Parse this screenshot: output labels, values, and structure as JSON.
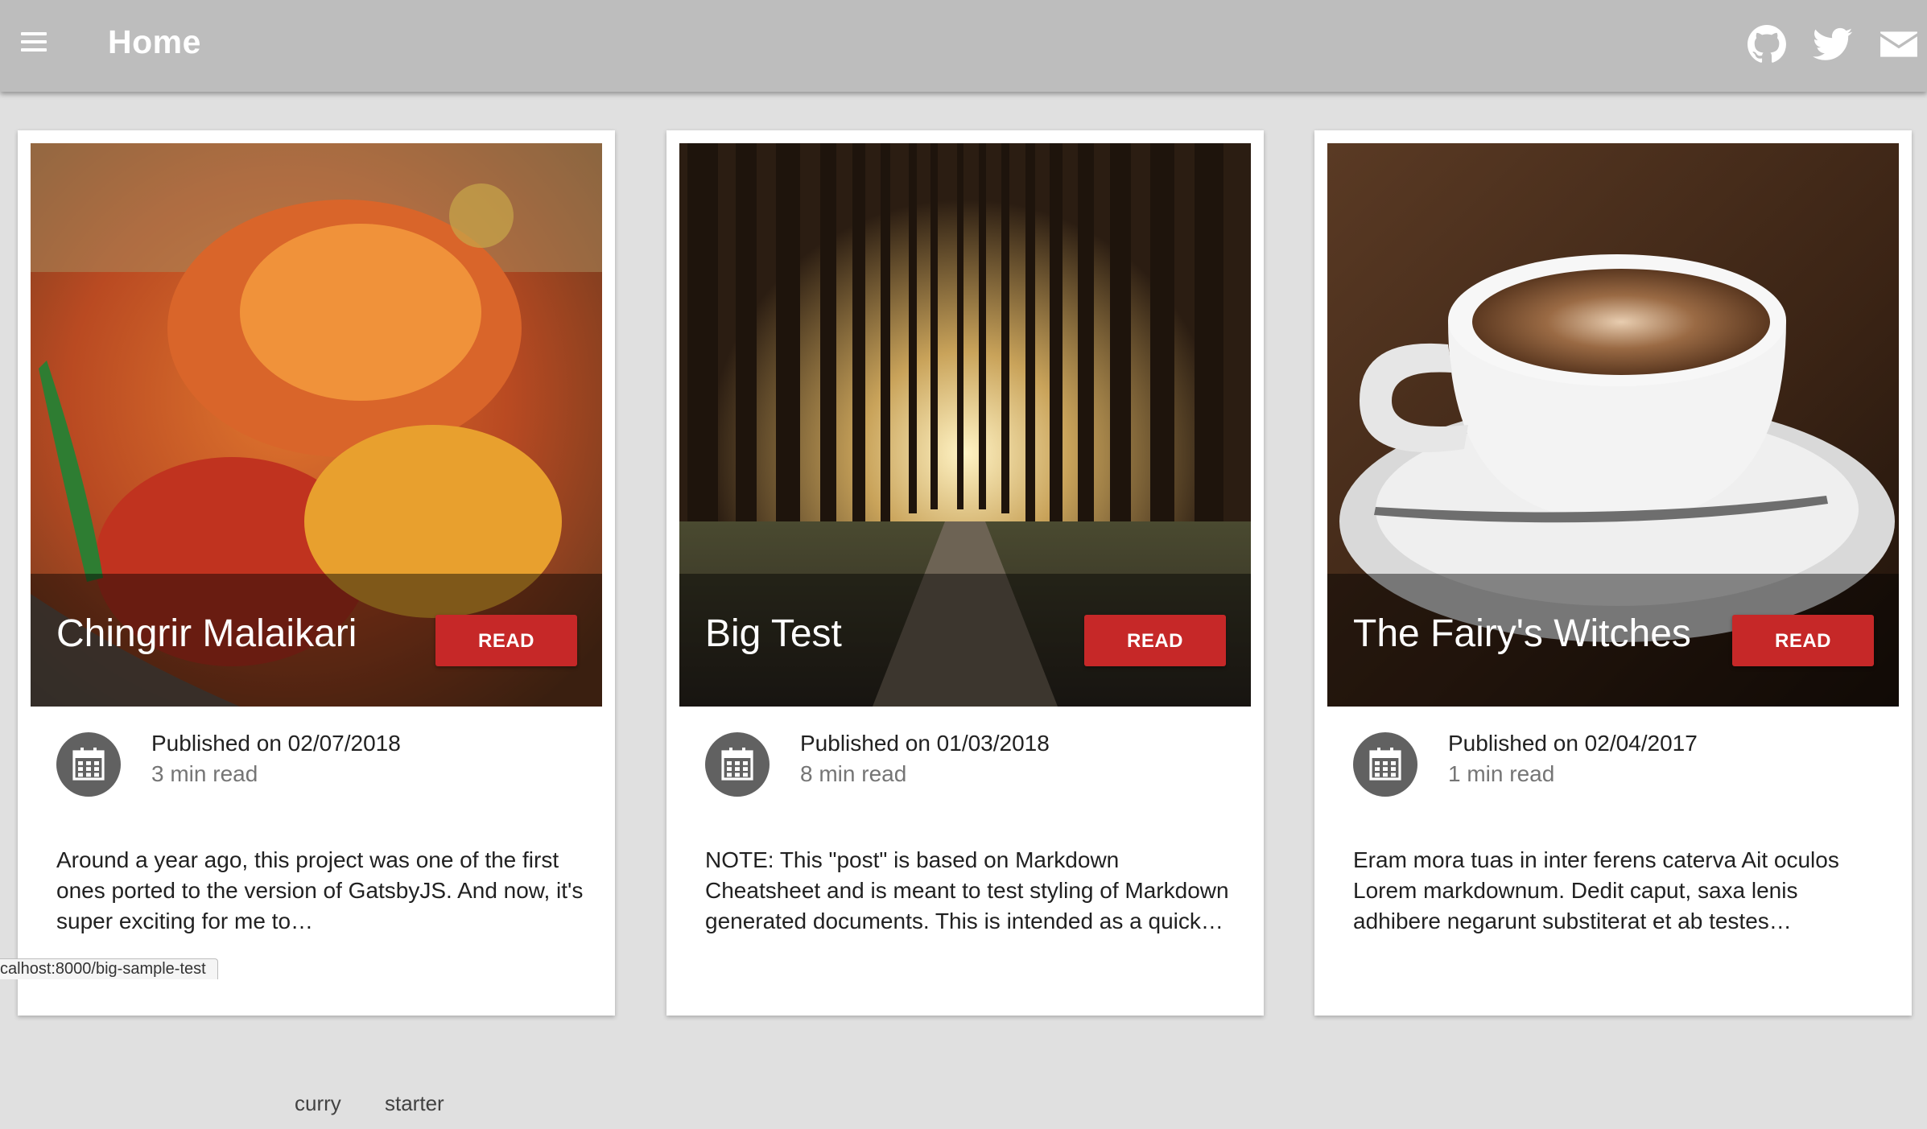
{
  "appbar": {
    "title": "Home",
    "icons": [
      "menu-icon",
      "github-icon",
      "twitter-icon",
      "mail-icon"
    ],
    "background": "#bdbdbd"
  },
  "posts": [
    {
      "title": "Chingrir Malaikari",
      "read_label": "READ",
      "published": "Published on 02/07/2018",
      "read_time": "3 min read",
      "excerpt": "Around a year ago, this project was one of the first ones ported to the version of GatsbyJS. And now, it's super exciting for me to…",
      "tags": [
        "curry",
        "starter"
      ]
    },
    {
      "title": "Big Test",
      "read_label": "READ",
      "published": "Published on 01/03/2018",
      "read_time": "8 min read",
      "excerpt": "NOTE: This \"post\" is based on Markdown Cheatsheet and is meant to test styling of Markdown generated documents. This is intended as a quick…",
      "tags": []
    },
    {
      "title": "The Fairy's Witches",
      "read_label": "READ",
      "published": "Published on 02/04/2017",
      "read_time": "1 min read",
      "excerpt": "Eram mora tuas in inter ferens caterva Ait oculos Lorem markdownum. Dedit caput, saxa lenis adhibere negarunt substiterat et ab testes…",
      "tags": []
    }
  ],
  "status_bar": {
    "url": "calhost:8000/big-sample-test"
  },
  "colors": {
    "accent": "#c62828",
    "card": "#ffffff",
    "page": "#e0e0e0"
  }
}
